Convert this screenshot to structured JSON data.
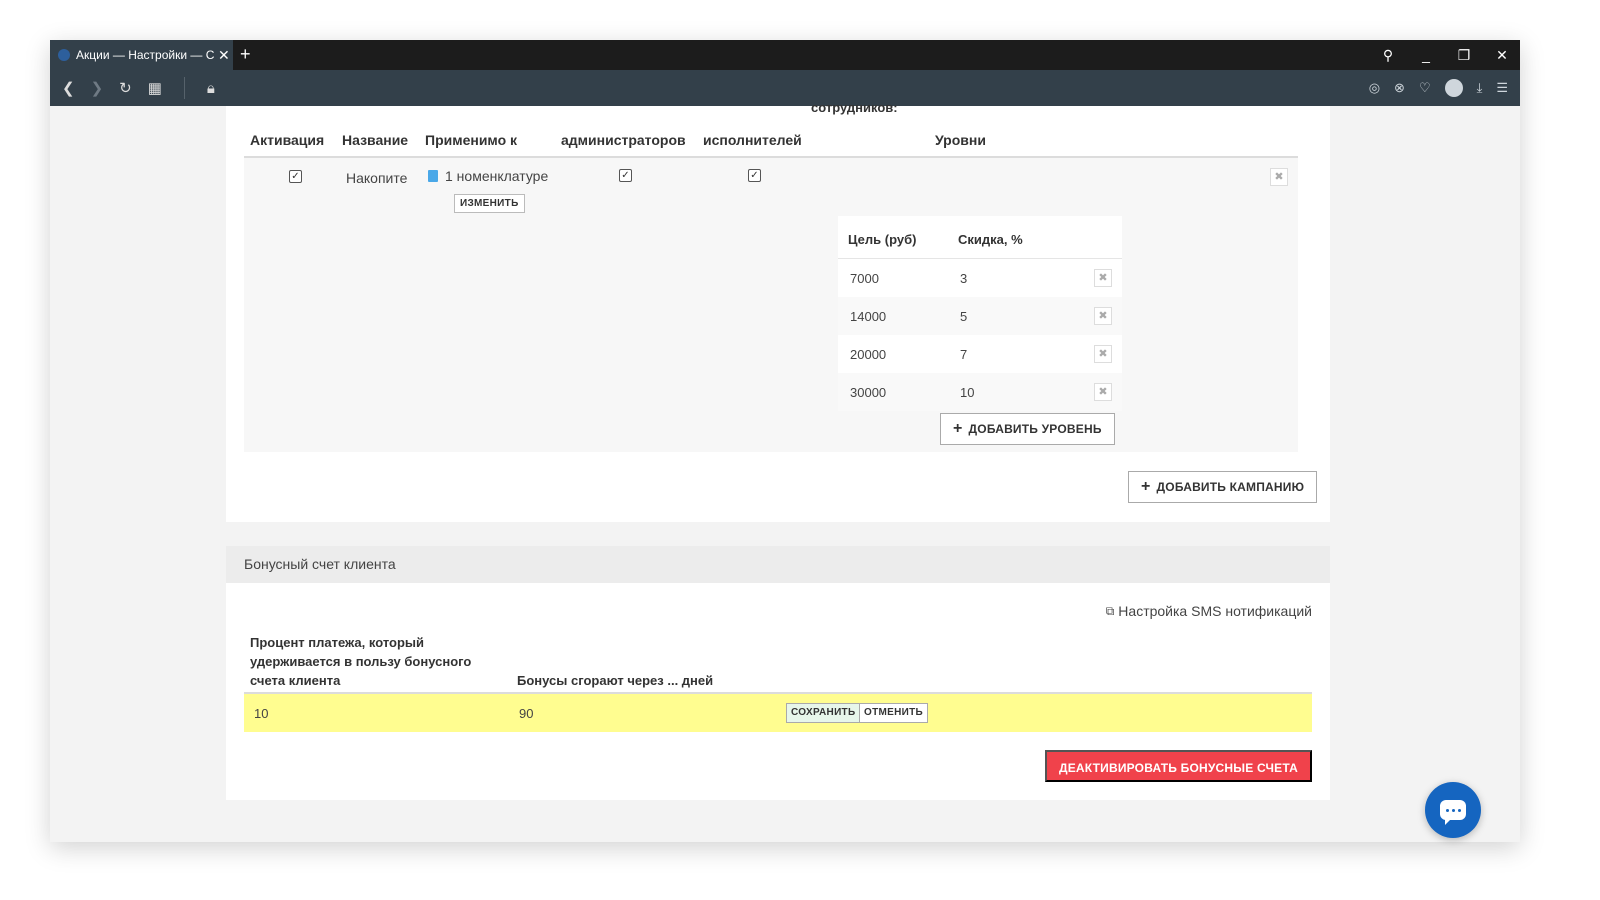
{
  "browser": {
    "tab_title": "Акции — Настройки — СС",
    "new_tab": "+"
  },
  "campaigns": {
    "cut_header_text": "сотрудников:",
    "headers": {
      "activation": "Активация",
      "name": "Название",
      "applicable": "Применимо к",
      "admins": "администраторов",
      "executors": "исполнителей",
      "levels": "Уровни"
    },
    "row": {
      "name": "Накопите",
      "applicable": "1 номенклатуре",
      "change_btn": "ИЗМЕНИТЬ"
    },
    "levels": {
      "goal_header": "Цель (руб)",
      "discount_header": "Скидка, %",
      "rows": [
        {
          "goal": "7000",
          "discount": "3"
        },
        {
          "goal": "14000",
          "discount": "5"
        },
        {
          "goal": "20000",
          "discount": "7"
        },
        {
          "goal": "30000",
          "discount": "10"
        }
      ],
      "add_level_btn": "ДОБАВИТЬ УРОВЕНЬ"
    },
    "add_campaign_btn": "ДОБАВИТЬ КАМПАНИЮ"
  },
  "bonus": {
    "section_title": "Бонусный счет клиента",
    "sms_link": "Настройка SMS нотификаций",
    "col_percent": "Процент платежа, который удерживается в пользу бонусного счета клиента",
    "col_expire": "Бонусы сгорают через ... дней",
    "percent_value": "10",
    "expire_value": "90",
    "save_btn": "СОХРАНИТЬ",
    "cancel_btn": "ОТМЕНИТЬ",
    "deactivate_btn": "ДЕАКТИВИРОВАТЬ БОНУСНЫЕ СЧЕТА"
  }
}
